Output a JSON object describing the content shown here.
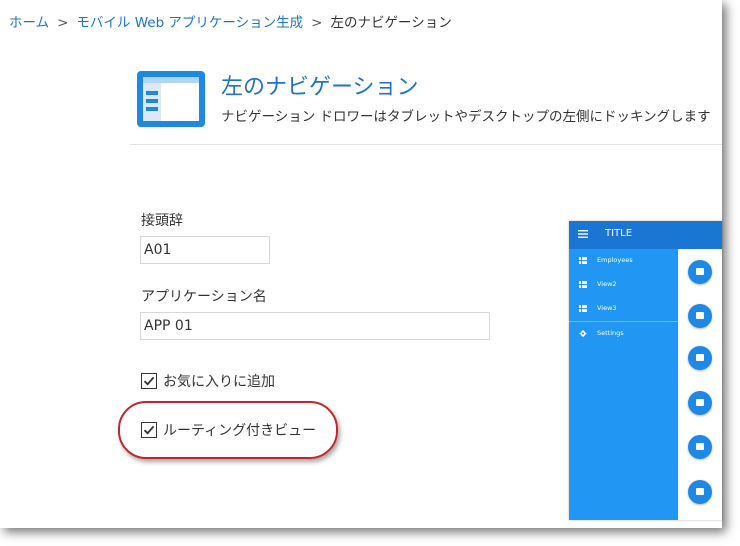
{
  "breadcrumb": {
    "home": "ホーム",
    "sep1": ">",
    "parent": "モバイル Web アプリケーション生成",
    "sep2": ">",
    "current": "左のナビゲーション"
  },
  "header": {
    "icon": "left-nav-layout-icon",
    "title": "左のナビゲーション",
    "description": "ナビゲーション ドロワーはタブレットやデスクトップの左側にドッキングします"
  },
  "form": {
    "prefix_label": "接頭辞",
    "prefix_value": "A01",
    "appname_label": "アプリケーション名",
    "appname_value": "APP 01",
    "favorite_label": "お気に入りに追加",
    "favorite_checked": true,
    "routing_label": "ルーティング付きビュー",
    "routing_checked": true
  },
  "preview": {
    "title": "TITLE",
    "menu": [
      {
        "icon": "view-list-icon",
        "label": "Employees"
      },
      {
        "icon": "view-list-icon",
        "label": "View2"
      },
      {
        "icon": "view-list-icon",
        "label": "View3"
      },
      {
        "icon": "gear-icon",
        "label": "Settings"
      }
    ],
    "fab_icon": "image-icon",
    "fab_count": 6
  },
  "colors": {
    "accent": "#1e73c8",
    "drawer": "#2196f3",
    "toolbar": "#1976d2",
    "highlight": "#c0272d"
  }
}
